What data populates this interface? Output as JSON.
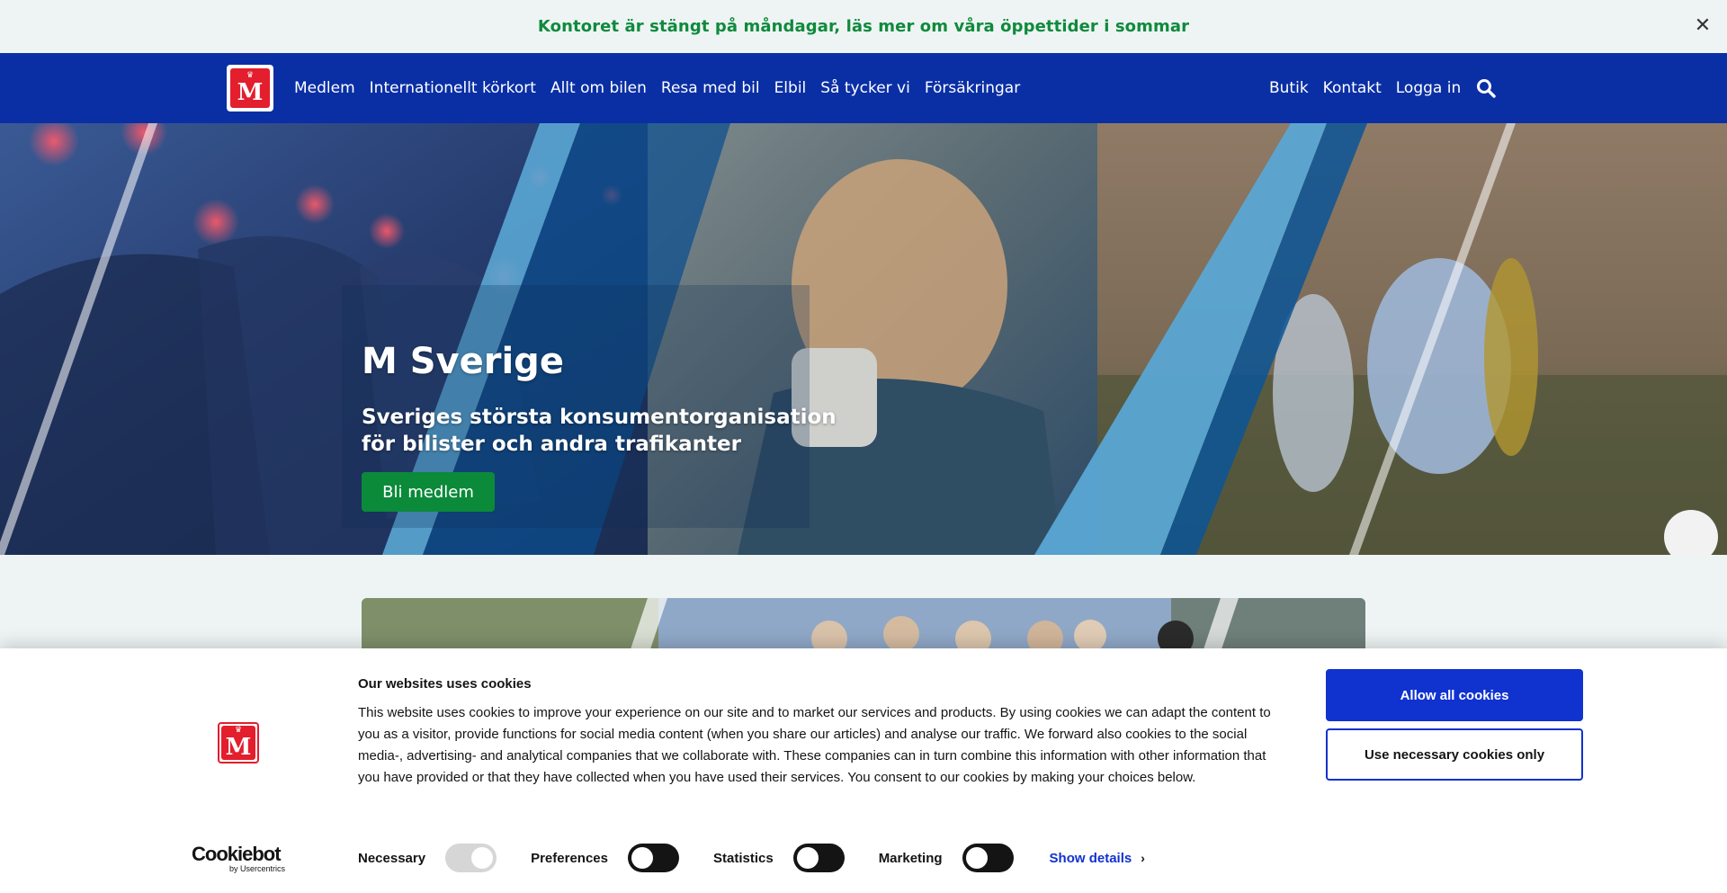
{
  "notice": {
    "text": "Kontoret är stängt på måndagar, läs mer om våra öppettider i sommar",
    "close_icon": "close-icon",
    "color": "#0f8a3c"
  },
  "nav": {
    "logo_icon": "m-sverige-logo",
    "links": [
      "Medlem",
      "Internationellt körkort",
      "Allt om bilen",
      "Resa med bil",
      "Elbil",
      "Så tycker vi",
      "Försäkringar"
    ],
    "right_links": [
      "Butik",
      "Kontakt",
      "Logga in"
    ],
    "search_icon": "search-icon",
    "background": "#0a2fa5"
  },
  "hero": {
    "title": "M Sverige",
    "subtitle": "Sveriges största konsumentorganisation för bilister och andra trafikanter",
    "button_label": "Bli medlem",
    "button_color": "#0b8a3a"
  },
  "cookie": {
    "heading": "Our websites uses cookies",
    "body": "This website uses cookies to improve your experience on our site and to market our services and products. By using cookies we can adapt the content to you as a visitor, provide functions for social media content (when you share our articles) and analyse our traffic. We forward also cookies to the social media-, advertising- and analytical companies that we collaborate with. These companies can in turn combine this information with other information that you have provided or that they have collected when you have used their services. You consent to our cookies by making your choices below.",
    "allow_label": "Allow all cookies",
    "necessary_label": "Use necessary cookies only",
    "brand": "Cookiebot",
    "brand_by": "by Usercentrics",
    "toggles": {
      "necessary": "Necessary",
      "preferences": "Preferences",
      "statistics": "Statistics",
      "marketing": "Marketing"
    },
    "show_details": "Show details",
    "accent": "#1032cf"
  }
}
